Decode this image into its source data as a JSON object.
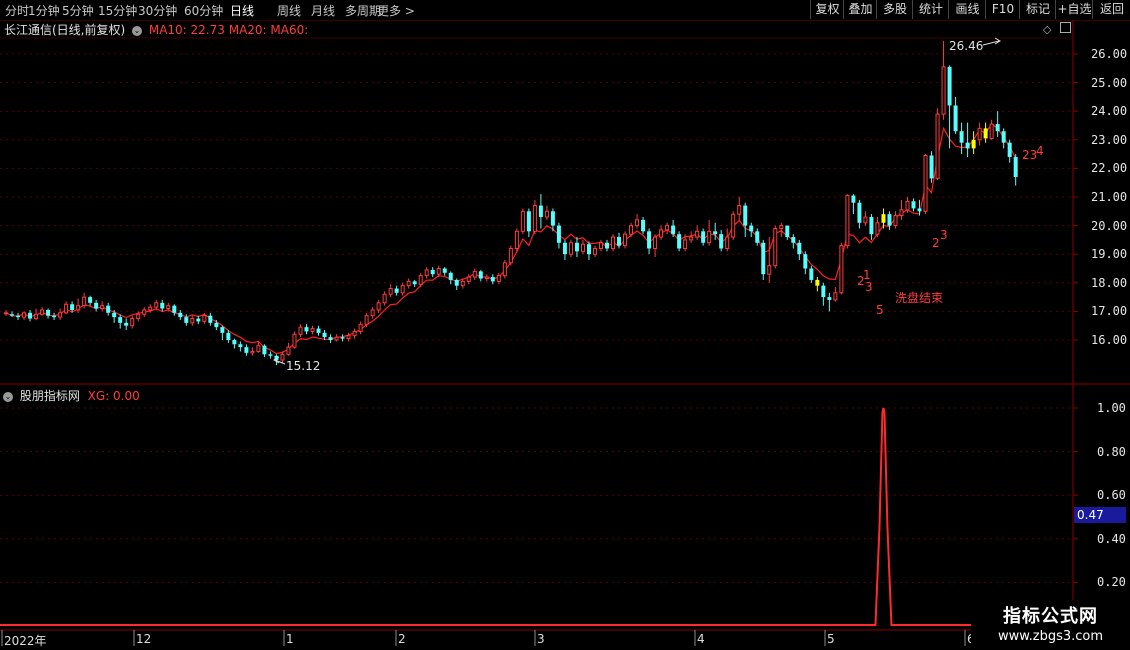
{
  "periods": [
    "分时",
    "1分钟",
    "5分钟",
    "15分钟",
    "30分钟",
    "60分钟",
    "日线",
    "周线",
    "月线",
    "多周期",
    "更多 >"
  ],
  "active_period": "日线",
  "right_buttons": [
    "复权",
    "叠加",
    "多股",
    "统计",
    "画线",
    "F10",
    "标记",
    "+自选",
    "返回"
  ],
  "stock": {
    "title": "长江通信(日线,前复权)",
    "ma10": "MA10: 22.73",
    "ma20": "MA20:",
    "ma60": "MA60:"
  },
  "indicator": {
    "title": "股朋指标网",
    "xg": "XG: 0.00",
    "current_value": "0.47"
  },
  "annotations": {
    "high": "26.46",
    "low": "15.12",
    "note": "洗盘结束",
    "num_5": "5",
    "num_2a": "2",
    "num_1": "1",
    "num_3a": "3",
    "num_2b": "2",
    "num_3b": "3",
    "num_23": "23",
    "num_4": "4"
  },
  "price_axis": [
    "26.00",
    "25.00",
    "24.00",
    "23.00",
    "22.00",
    "21.00",
    "20.00",
    "19.00",
    "18.00",
    "17.00",
    "16.00"
  ],
  "indicator_axis": [
    "1.00",
    "0.80",
    "0.60",
    "0.40",
    "0.20"
  ],
  "time_axis": [
    "2022年",
    "12",
    "1",
    "2",
    "3",
    "4",
    "5",
    "6"
  ],
  "watermark": {
    "title": "指标公式网",
    "url": "www.zbgs3.com"
  },
  "colors": {
    "up": "#ff3c3c",
    "down": "#54ffff",
    "signal": "#ffff00",
    "ma": "#ff2020",
    "grid": "#5a0000"
  },
  "candles": [
    [
      16.95,
      16.95,
      16.85,
      17.05
    ],
    [
      16.9,
      16.85,
      16.8,
      17.0
    ],
    [
      16.85,
      16.8,
      16.7,
      16.95
    ],
    [
      16.8,
      16.95,
      16.7,
      17.0
    ],
    [
      16.95,
      16.75,
      16.65,
      17.05
    ],
    [
      16.75,
      16.9,
      16.7,
      17.1
    ],
    [
      16.9,
      17.05,
      16.85,
      17.15
    ],
    [
      17.05,
      16.85,
      16.75,
      17.1
    ],
    [
      16.85,
      16.8,
      16.7,
      16.95
    ],
    [
      16.8,
      16.95,
      16.7,
      17.1
    ],
    [
      16.95,
      17.25,
      16.9,
      17.35
    ],
    [
      17.25,
      17.05,
      16.95,
      17.35
    ],
    [
      17.05,
      17.2,
      16.95,
      17.45
    ],
    [
      17.2,
      17.5,
      17.1,
      17.65
    ],
    [
      17.5,
      17.3,
      17.2,
      17.55
    ],
    [
      17.3,
      17.1,
      17.0,
      17.4
    ],
    [
      17.1,
      17.2,
      17.0,
      17.35
    ],
    [
      17.2,
      16.95,
      16.85,
      17.3
    ],
    [
      16.95,
      16.8,
      16.6,
      17.05
    ],
    [
      16.8,
      16.6,
      16.4,
      16.9
    ],
    [
      16.6,
      16.5,
      16.35,
      16.75
    ],
    [
      16.5,
      16.75,
      16.4,
      16.85
    ],
    [
      16.75,
      16.9,
      16.65,
      17.0
    ],
    [
      16.9,
      17.05,
      16.8,
      17.15
    ],
    [
      17.05,
      17.15,
      16.95,
      17.25
    ],
    [
      17.15,
      17.3,
      17.05,
      17.4
    ],
    [
      17.3,
      17.1,
      17.0,
      17.4
    ],
    [
      17.1,
      17.2,
      17.0,
      17.3
    ],
    [
      17.2,
      16.95,
      16.85,
      17.25
    ],
    [
      16.95,
      16.8,
      16.7,
      17.05
    ],
    [
      16.8,
      16.6,
      16.5,
      16.9
    ],
    [
      16.6,
      16.75,
      16.5,
      16.85
    ],
    [
      16.75,
      16.65,
      16.55,
      16.85
    ],
    [
      16.65,
      16.85,
      16.55,
      16.95
    ],
    [
      16.85,
      16.6,
      16.5,
      16.95
    ],
    [
      16.6,
      16.45,
      16.35,
      16.7
    ],
    [
      16.45,
      16.25,
      16.0,
      16.5
    ],
    [
      16.25,
      16.0,
      15.9,
      16.35
    ],
    [
      16.0,
      15.85,
      15.7,
      16.05
    ],
    [
      15.85,
      15.75,
      15.6,
      15.95
    ],
    [
      15.75,
      15.55,
      15.45,
      15.85
    ],
    [
      15.55,
      15.6,
      15.45,
      15.75
    ],
    [
      15.6,
      15.8,
      15.55,
      15.95
    ],
    [
      15.8,
      15.5,
      15.4,
      15.85
    ],
    [
      15.5,
      15.45,
      15.35,
      15.6
    ],
    [
      15.45,
      15.3,
      15.12,
      15.5
    ],
    [
      15.3,
      15.5,
      15.2,
      15.6
    ],
    [
      15.5,
      15.75,
      15.45,
      15.9
    ],
    [
      15.75,
      16.2,
      15.7,
      16.3
    ],
    [
      16.2,
      16.45,
      16.1,
      16.55
    ],
    [
      16.45,
      16.3,
      16.2,
      16.55
    ],
    [
      16.3,
      16.4,
      16.2,
      16.5
    ],
    [
      16.4,
      16.25,
      16.15,
      16.5
    ],
    [
      16.25,
      16.1,
      16.0,
      16.35
    ],
    [
      16.1,
      16.0,
      15.9,
      16.2
    ],
    [
      16.0,
      16.1,
      15.95,
      16.2
    ],
    [
      16.1,
      16.05,
      15.95,
      16.2
    ],
    [
      16.05,
      16.15,
      15.95,
      16.25
    ],
    [
      16.15,
      16.3,
      16.05,
      16.4
    ],
    [
      16.3,
      16.55,
      16.2,
      16.65
    ],
    [
      16.55,
      16.85,
      16.45,
      16.95
    ],
    [
      16.85,
      17.05,
      16.75,
      17.15
    ],
    [
      17.05,
      17.3,
      16.95,
      17.4
    ],
    [
      17.3,
      17.6,
      17.2,
      17.7
    ],
    [
      17.6,
      17.8,
      17.5,
      17.95
    ],
    [
      17.8,
      17.65,
      17.55,
      17.9
    ],
    [
      17.65,
      17.9,
      17.55,
      18.0
    ],
    [
      17.9,
      18.05,
      17.8,
      18.15
    ],
    [
      18.05,
      17.95,
      17.85,
      18.1
    ],
    [
      17.95,
      18.25,
      17.85,
      18.35
    ],
    [
      18.25,
      18.45,
      18.15,
      18.55
    ],
    [
      18.45,
      18.3,
      18.2,
      18.55
    ],
    [
      18.3,
      18.5,
      18.2,
      18.6
    ],
    [
      18.5,
      18.35,
      18.25,
      18.55
    ],
    [
      18.35,
      18.1,
      17.95,
      18.4
    ],
    [
      18.1,
      17.9,
      17.75,
      18.15
    ],
    [
      17.9,
      18.05,
      17.8,
      18.15
    ],
    [
      18.05,
      18.2,
      17.95,
      18.3
    ],
    [
      18.2,
      18.4,
      18.1,
      18.5
    ],
    [
      18.4,
      18.15,
      18.05,
      18.45
    ],
    [
      18.15,
      18.2,
      18.05,
      18.3
    ],
    [
      18.2,
      18.05,
      17.95,
      18.3
    ],
    [
      18.05,
      18.25,
      17.95,
      18.35
    ],
    [
      18.25,
      18.7,
      18.15,
      18.8
    ],
    [
      18.7,
      19.2,
      18.6,
      19.3
    ],
    [
      19.2,
      19.8,
      19.1,
      19.9
    ],
    [
      19.8,
      20.5,
      19.7,
      20.6
    ],
    [
      20.5,
      19.8,
      19.6,
      20.6
    ],
    [
      19.8,
      20.7,
      19.7,
      20.9
    ],
    [
      20.7,
      20.3,
      19.9,
      21.1
    ],
    [
      20.3,
      20.5,
      20.2,
      20.7
    ],
    [
      20.5,
      20.0,
      19.8,
      20.6
    ],
    [
      20.0,
      19.4,
      19.2,
      20.1
    ],
    [
      19.4,
      19.0,
      18.8,
      19.5
    ],
    [
      19.0,
      19.4,
      18.9,
      19.5
    ],
    [
      19.4,
      19.1,
      18.9,
      19.6
    ],
    [
      19.1,
      19.35,
      19.0,
      19.5
    ],
    [
      19.35,
      19.0,
      18.8,
      19.45
    ],
    [
      19.0,
      19.2,
      18.9,
      19.3
    ],
    [
      19.2,
      19.4,
      19.1,
      19.5
    ],
    [
      19.4,
      19.2,
      19.1,
      19.5
    ],
    [
      19.2,
      19.6,
      19.1,
      19.7
    ],
    [
      19.6,
      19.3,
      19.2,
      19.75
    ],
    [
      19.3,
      19.7,
      19.2,
      19.8
    ],
    [
      19.7,
      20.0,
      19.6,
      20.1
    ],
    [
      20.0,
      20.2,
      19.9,
      20.4
    ],
    [
      20.2,
      19.8,
      19.7,
      20.3
    ],
    [
      19.8,
      19.2,
      19.0,
      19.9
    ],
    [
      19.2,
      19.6,
      18.9,
      19.7
    ],
    [
      19.6,
      19.85,
      19.5,
      20.0
    ],
    [
      19.85,
      20.0,
      19.7,
      20.1
    ],
    [
      20.0,
      19.7,
      19.6,
      20.2
    ],
    [
      19.7,
      19.2,
      19.1,
      19.8
    ],
    [
      19.2,
      19.5,
      19.1,
      19.7
    ],
    [
      19.5,
      19.6,
      19.4,
      19.8
    ],
    [
      19.6,
      19.8,
      19.5,
      20.0
    ],
    [
      19.8,
      19.4,
      19.3,
      19.9
    ],
    [
      19.4,
      19.8,
      19.3,
      20.2
    ],
    [
      19.8,
      19.7,
      19.5,
      20.1
    ],
    [
      19.7,
      19.2,
      19.1,
      19.85
    ],
    [
      19.2,
      19.6,
      19.1,
      19.9
    ],
    [
      19.6,
      20.4,
      19.5,
      20.5
    ],
    [
      20.4,
      20.7,
      20.2,
      21.0
    ],
    [
      20.7,
      20.0,
      19.6,
      20.8
    ],
    [
      20.0,
      19.8,
      19.6,
      20.1
    ],
    [
      19.8,
      19.4,
      19.3,
      19.9
    ],
    [
      19.4,
      18.3,
      18.1,
      19.5
    ],
    [
      18.3,
      18.6,
      18.0,
      19.6
    ],
    [
      18.6,
      19.9,
      18.5,
      20.0
    ],
    [
      19.9,
      20.0,
      19.6,
      20.1
    ],
    [
      20.0,
      19.6,
      19.5,
      20.0
    ],
    [
      19.6,
      19.4,
      19.2,
      19.7
    ],
    [
      19.4,
      19.0,
      18.8,
      19.5
    ],
    [
      19.0,
      18.5,
      18.3,
      19.1
    ],
    [
      18.5,
      18.1,
      18.0,
      18.6
    ],
    [
      18.1,
      17.9,
      17.7,
      18.2
    ],
    [
      17.9,
      17.5,
      17.2,
      18.0
    ],
    [
      17.5,
      17.4,
      17.0,
      17.65
    ],
    [
      17.4,
      17.65,
      17.35,
      17.85
    ],
    [
      17.65,
      19.3,
      17.6,
      19.4
    ],
    [
      19.3,
      21.05,
      19.2,
      21.1
    ],
    [
      21.05,
      20.8,
      20.4,
      21.1
    ],
    [
      20.8,
      20.1,
      19.9,
      20.9
    ],
    [
      20.1,
      20.3,
      20.0,
      20.5
    ],
    [
      20.3,
      19.7,
      19.5,
      20.4
    ],
    [
      19.7,
      20.1,
      19.6,
      20.3
    ],
    [
      20.1,
      20.4,
      19.9,
      20.6
    ],
    [
      20.4,
      20.0,
      19.85,
      20.5
    ],
    [
      20.0,
      20.35,
      19.9,
      20.5
    ],
    [
      20.35,
      20.55,
      20.2,
      20.9
    ],
    [
      20.55,
      20.85,
      20.45,
      21.0
    ],
    [
      20.85,
      20.6,
      20.5,
      20.95
    ],
    [
      20.6,
      20.5,
      20.35,
      20.9
    ],
    [
      20.5,
      22.45,
      20.4,
      22.5
    ],
    [
      22.45,
      21.65,
      21.5,
      22.6
    ],
    [
      21.65,
      23.9,
      21.6,
      24.1
    ],
    [
      23.9,
      25.55,
      23.7,
      26.46
    ],
    [
      25.55,
      24.2,
      22.7,
      25.6
    ],
    [
      24.2,
      23.3,
      23.2,
      24.5
    ],
    [
      23.3,
      22.9,
      22.5,
      23.6
    ],
    [
      22.9,
      22.7,
      22.4,
      23.6
    ],
    [
      22.7,
      23.0,
      22.5,
      23.3
    ],
    [
      23.0,
      23.4,
      22.8,
      23.6
    ],
    [
      23.4,
      23.05,
      22.9,
      23.6
    ],
    [
      23.05,
      23.55,
      23.0,
      23.7
    ],
    [
      23.55,
      23.3,
      23.1,
      24.0
    ],
    [
      23.3,
      22.9,
      22.7,
      23.4
    ],
    [
      22.9,
      22.4,
      22.2,
      23.0
    ],
    [
      22.4,
      21.7,
      21.4,
      22.5
    ]
  ],
  "signal_indices": [
    135,
    146,
    161,
    163
  ],
  "indicator_peak_index": 146
}
